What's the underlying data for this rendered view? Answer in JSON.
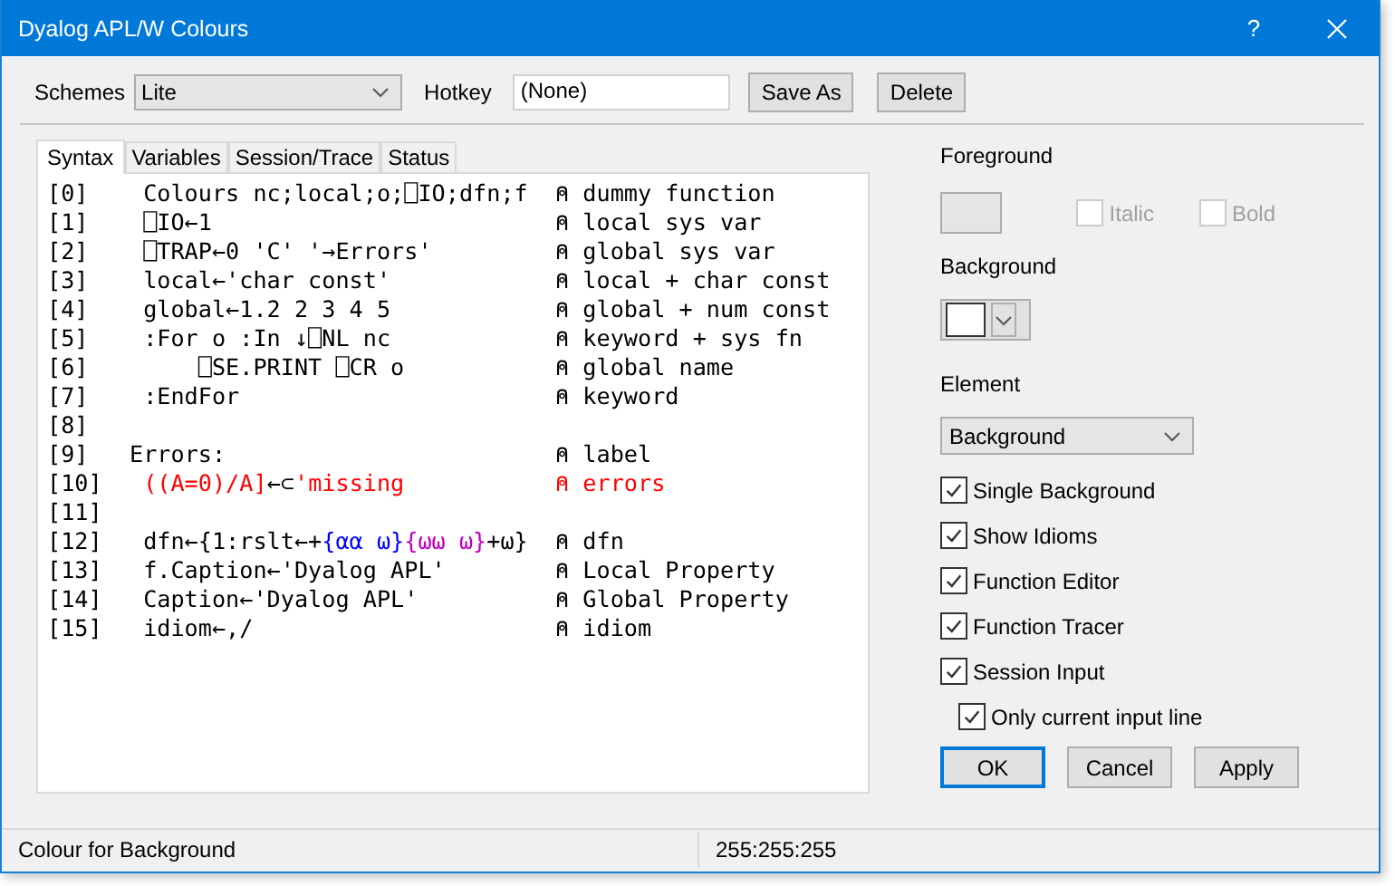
{
  "window": {
    "title": "Dyalog APL/W Colours",
    "help": "?"
  },
  "toolbar": {
    "schemes_label": "Schemes",
    "scheme": "Lite",
    "hotkey_label": "Hotkey",
    "hotkey": "(None)",
    "buttons": [
      "Save As",
      "Delete"
    ]
  },
  "tabs": [
    {
      "label": "Syntax",
      "selected": true
    },
    {
      "label": "Variables",
      "selected": false
    },
    {
      "label": "Session/Trace",
      "selected": false
    },
    {
      "label": "Status",
      "selected": false
    }
  ],
  "code_lines": [
    {
      "number": "[0]",
      "kind": "statement",
      "code": [
        {
          "text": "Colours nc;local;o;⎕IO;dfn;f",
          "color": "#000000"
        }
      ],
      "comment": {
        "text": "⍝ dummy function",
        "color": "#000000"
      }
    },
    {
      "number": "[1]",
      "kind": "statement",
      "code": [
        {
          "text": "⎕IO←1",
          "color": "#000000"
        }
      ],
      "comment": {
        "text": "⍝ local sys var",
        "color": "#000000"
      }
    },
    {
      "number": "[2]",
      "kind": "statement",
      "code": [
        {
          "text": "⎕TRAP←0 'C' '→Errors'",
          "color": "#000000"
        }
      ],
      "comment": {
        "text": "⍝ global sys var",
        "color": "#000000"
      }
    },
    {
      "number": "[3]",
      "kind": "statement",
      "code": [
        {
          "text": "local←'char const'",
          "color": "#000000"
        }
      ],
      "comment": {
        "text": "⍝ local + char const",
        "color": "#000000"
      }
    },
    {
      "number": "[4]",
      "kind": "statement",
      "code": [
        {
          "text": "global←1.2 2 3 4 5",
          "color": "#000000"
        }
      ],
      "comment": {
        "text": "⍝ global + num const",
        "color": "#000000"
      }
    },
    {
      "number": "[5]",
      "kind": "statement",
      "code": [
        {
          "text": ":For o :In ↓⎕NL nc",
          "color": "#000000"
        }
      ],
      "comment": {
        "text": "⍝ keyword + sys fn",
        "color": "#000000"
      }
    },
    {
      "number": "[6]",
      "kind": "nested",
      "code": [
        {
          "text": "⎕SE.PRINT ⎕CR o",
          "color": "#000000"
        }
      ],
      "comment": {
        "text": "⍝ global name",
        "color": "#000000"
      }
    },
    {
      "number": "[7]",
      "kind": "statement",
      "code": [
        {
          "text": ":EndFor",
          "color": "#000000"
        }
      ],
      "comment": {
        "text": "⍝ keyword",
        "color": "#000000"
      }
    },
    {
      "number": "[8]",
      "kind": "statement"
    },
    {
      "number": "[9]",
      "kind": "label",
      "code": [
        {
          "text": "Errors:",
          "color": "#000000"
        }
      ],
      "comment": {
        "text": "⍝ label",
        "color": "#000000"
      }
    },
    {
      "number": "[10]",
      "kind": "statement",
      "code": [
        {
          "text": "((A=0)/A]",
          "color": "#ff0000"
        },
        {
          "text": "←⊂",
          "color": "#000000"
        },
        {
          "text": "'missing",
          "color": "#ff0000"
        }
      ],
      "comment": {
        "text": "⍝ errors",
        "color": "#ff0000"
      }
    },
    {
      "number": "[11]",
      "kind": "statement"
    },
    {
      "number": "[12]",
      "kind": "statement",
      "code": [
        {
          "text": "dfn←{1:rslt←+",
          "color": "#000000"
        },
        {
          "text": "{αα ω}",
          "color": "#0000ff"
        },
        {
          "text": "{ωω ω}",
          "color": "#c000c0"
        },
        {
          "text": "+ω}",
          "color": "#000000"
        }
      ],
      "comment": {
        "text": "⍝ dfn",
        "color": "#000000"
      }
    },
    {
      "number": "[13]",
      "kind": "statement",
      "code": [
        {
          "text": "f.Caption←'Dyalog APL'",
          "color": "#000000"
        }
      ],
      "comment": {
        "text": "⍝ Local Property",
        "color": "#000000"
      }
    },
    {
      "number": "[14]",
      "kind": "statement",
      "code": [
        {
          "text": "Caption←'Dyalog APL'",
          "color": "#000000"
        }
      ],
      "comment": {
        "text": "⍝ Global Property",
        "color": "#000000"
      }
    },
    {
      "number": "[15]",
      "kind": "statement",
      "code": [
        {
          "text": "idiom←,/",
          "color": "#000000"
        }
      ],
      "comment": {
        "text": "⍝ idiom",
        "color": "#000000"
      }
    }
  ],
  "colour_panel": {
    "foreground_label": "Foreground",
    "foreground_disabled": true,
    "style_options": [
      {
        "label": "Italic",
        "checked": false,
        "disabled": true
      },
      {
        "label": "Bold",
        "checked": false,
        "disabled": true
      }
    ],
    "background_label": "Background",
    "element_label": "Element",
    "element": "Background",
    "options": [
      {
        "label": "Single Background",
        "checked": true,
        "kind": "option"
      },
      {
        "label": "Show Idioms",
        "checked": true,
        "kind": "option"
      },
      {
        "label": "Function Editor",
        "checked": true,
        "kind": "option"
      },
      {
        "label": "Function Tracer",
        "checked": true,
        "kind": "option"
      },
      {
        "label": "Session Input",
        "checked": true,
        "kind": "option"
      },
      {
        "label": "Only current input line",
        "checked": true,
        "kind": "suboption"
      }
    ]
  },
  "buttons": [
    {
      "label": "OK",
      "default": true
    },
    {
      "label": "Cancel",
      "default": false
    },
    {
      "label": "Apply",
      "default": false
    }
  ],
  "status_bar": [
    "Colour for Background",
    "255:255:255"
  ]
}
